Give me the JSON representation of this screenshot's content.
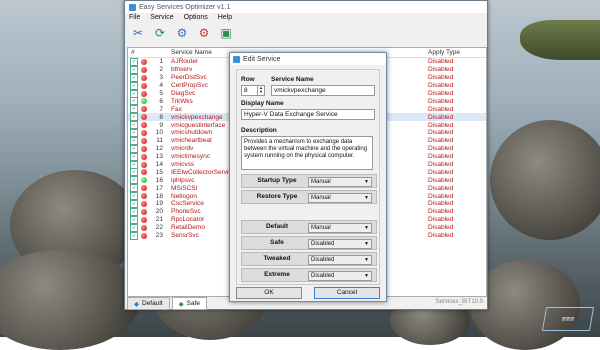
{
  "window": {
    "title": "Easy Services Optimizer v1.1",
    "menu": [
      "File",
      "Service",
      "Options",
      "Help"
    ]
  },
  "list": {
    "headers": {
      "num": "#",
      "name": "Service Name",
      "status": "Apply Type"
    },
    "rows": [
      {
        "num": "1",
        "name": "AJRouter",
        "status": "Disabled",
        "dot": "red"
      },
      {
        "num": "2",
        "name": "bthserv",
        "status": "Disabled",
        "dot": "red"
      },
      {
        "num": "3",
        "name": "PeerDistSvc",
        "status": "Disabled",
        "dot": "red"
      },
      {
        "num": "4",
        "name": "CertPropSvc",
        "status": "Disabled",
        "dot": "red"
      },
      {
        "num": "5",
        "name": "DiagSvc",
        "status": "Disabled",
        "dot": "red"
      },
      {
        "num": "6",
        "name": "TrkWks",
        "status": "Disabled",
        "dot": "green"
      },
      {
        "num": "7",
        "name": "Fax",
        "status": "Disabled",
        "dot": "red"
      },
      {
        "num": "8",
        "name": "vmickvpexchange",
        "status": "Disabled",
        "dot": "red"
      },
      {
        "num": "9",
        "name": "vmicguestinterface",
        "status": "Disabled",
        "dot": "red"
      },
      {
        "num": "10",
        "name": "vmicshutdown",
        "status": "Disabled",
        "dot": "red"
      },
      {
        "num": "11",
        "name": "vmicheartbeat",
        "status": "Disabled",
        "dot": "red"
      },
      {
        "num": "12",
        "name": "vmicrdv",
        "status": "Disabled",
        "dot": "red"
      },
      {
        "num": "13",
        "name": "vmictimesync",
        "status": "Disabled",
        "dot": "red"
      },
      {
        "num": "14",
        "name": "vmicvss",
        "status": "Disabled",
        "dot": "red"
      },
      {
        "num": "15",
        "name": "IEEtwCollectorService",
        "status": "Disabled",
        "dot": "red"
      },
      {
        "num": "16",
        "name": "iphlpsvc",
        "status": "Disabled",
        "dot": "green"
      },
      {
        "num": "17",
        "name": "MSiSCSI",
        "status": "Disabled",
        "dot": "red"
      },
      {
        "num": "18",
        "name": "Netlogon",
        "status": "Disabled",
        "dot": "red"
      },
      {
        "num": "19",
        "name": "CscService",
        "status": "Disabled",
        "dot": "red"
      },
      {
        "num": "20",
        "name": "PhoneSvc",
        "status": "Disabled",
        "dot": "red"
      },
      {
        "num": "21",
        "name": "RpcLocator",
        "status": "Disabled",
        "dot": "red"
      },
      {
        "num": "22",
        "name": "RetailDemo",
        "status": "Disabled",
        "dot": "red"
      },
      {
        "num": "23",
        "name": "SensrSvc",
        "status": "Disabled",
        "dot": "red"
      }
    ]
  },
  "tabs": [
    "Default",
    "Safe"
  ],
  "status_version": "Services_BIT10.0",
  "dialog": {
    "title": "Edit Service",
    "row_label": "Row",
    "row_value": "8",
    "service_name_label": "Service Name",
    "service_name_value": "vmickvpexchange",
    "display_name_label": "Display Name",
    "display_name_value": "Hyper-V Data Exchange Service",
    "description_label": "Description",
    "description_value": "Provides a mechanism to exchange data between the virtual machine and the operating system running on the physical computer.",
    "startup_type_label": "Startup Type",
    "startup_type_value": "Manual",
    "restore_type_label": "Restore Type",
    "restore_type_value": "Manual",
    "default_label": "Default",
    "default_value": "Manual",
    "safe_label": "Safe",
    "safe_value": "Disabled",
    "tweaked_label": "Tweaked",
    "tweaked_value": "Disabled",
    "extreme_label": "Extreme",
    "extreme_value": "Disabled",
    "ok_label": "OK",
    "cancel_label": "Cancel"
  }
}
